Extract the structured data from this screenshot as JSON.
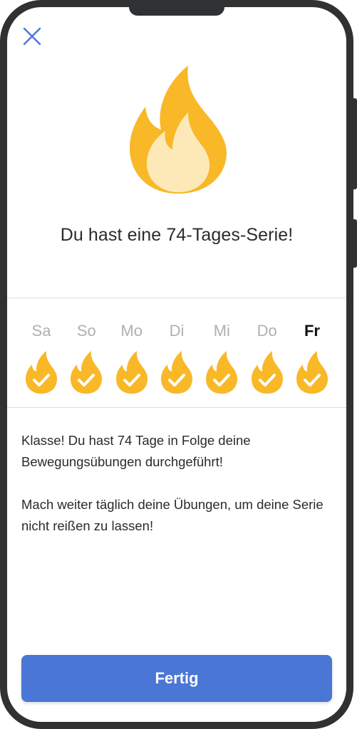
{
  "colors": {
    "accent": "#4a76d6",
    "flame_outer": "#f8b828",
    "flame_inner": "#fde9b8",
    "check": "#ffffff",
    "day_inactive": "#b0b0b0",
    "day_active": "#111111"
  },
  "header": {
    "close_icon": "close-icon"
  },
  "hero": {
    "icon": "flame-icon"
  },
  "streak": {
    "title": "Du hast eine 74-Tages-Serie!",
    "days": [
      {
        "label": "Sa",
        "completed": true,
        "current": false
      },
      {
        "label": "So",
        "completed": true,
        "current": false
      },
      {
        "label": "Mo",
        "completed": true,
        "current": false
      },
      {
        "label": "Di",
        "completed": true,
        "current": false
      },
      {
        "label": "Mi",
        "completed": true,
        "current": false
      },
      {
        "label": "Do",
        "completed": true,
        "current": false
      },
      {
        "label": "Fr",
        "completed": true,
        "current": true
      }
    ]
  },
  "message": {
    "paragraph1": "Klasse! Du hast 74 Tage in Folge deine Bewegungsübungen durchgeführt!",
    "paragraph2": "Mach weiter täglich deine Übungen, um deine Serie nicht reißen zu lassen!"
  },
  "footer": {
    "done_label": "Fertig"
  }
}
